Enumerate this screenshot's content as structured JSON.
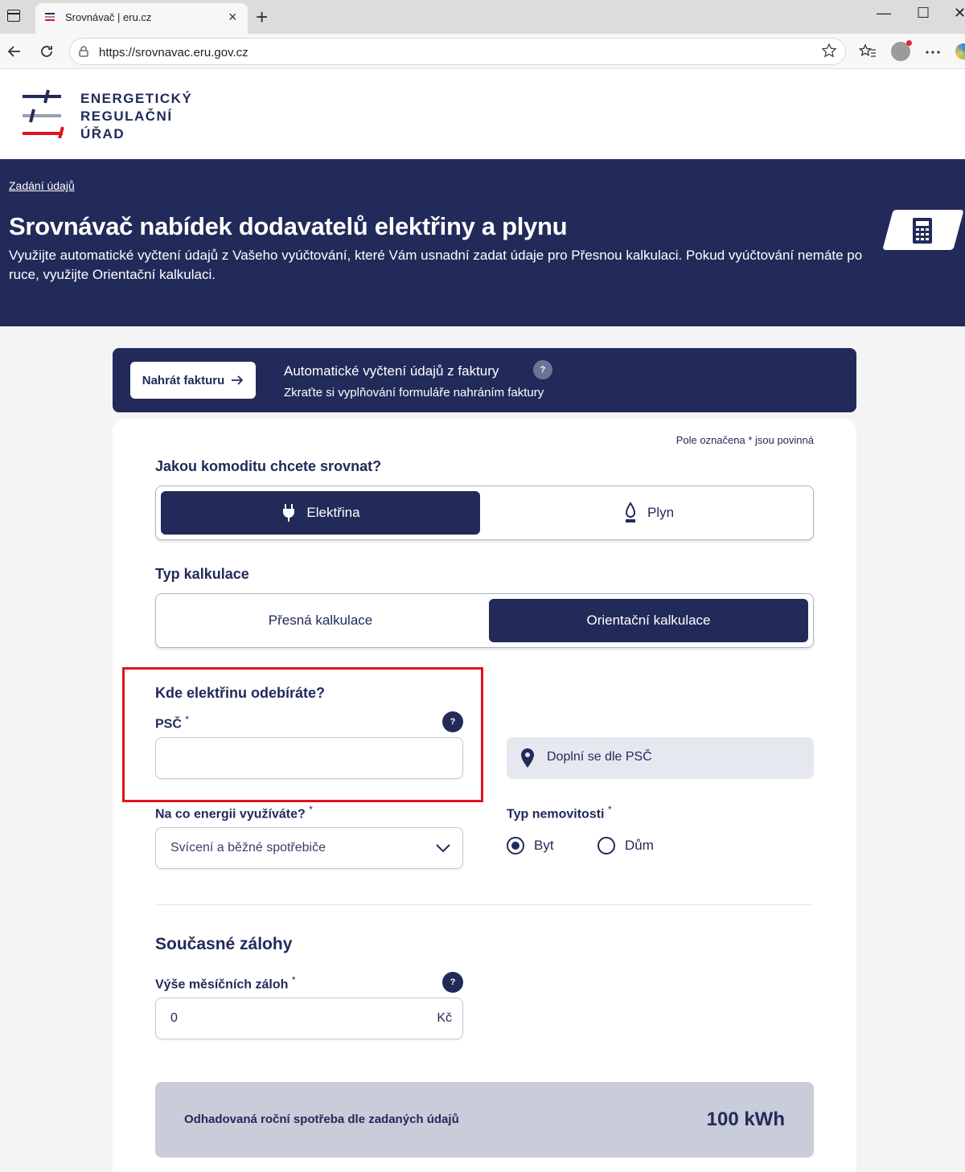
{
  "browser": {
    "tab_title": "Srovnávač | eru.cz",
    "tab_close": "×",
    "new_tab": "+",
    "url": "https://srovnavac.eru.gov.cz",
    "minimize": "—",
    "maximize": "☐",
    "close": "✕",
    "icons": [
      "back-icon",
      "reload-icon",
      "lock-icon",
      "star-icon",
      "favorites-icon",
      "profile-icon",
      "more-icon",
      "edge-icon"
    ]
  },
  "logo": {
    "lines": [
      "ENERGETICKÝ",
      "REGULAČNÍ",
      "ÚŘAD"
    ]
  },
  "hero": {
    "breadcrumb": "Zadání údajů",
    "title": "Srovnávač nabídek dodavatelů elektřiny a plynu",
    "description": "Využijte automatické vyčtení údajů z Vašeho vyúčtování, které Vám usnadní zadat údaje pro Přesnou kalkulaci. Pokud vyúčtování nemáte po ruce, využijte Orientační kalkulaci."
  },
  "upload": {
    "button_label": "Nahrát fakturu",
    "title": "Automatické vyčtení údajů z faktury",
    "subtitle": "Zkraťte si vyplňování formuláře nahráním faktury",
    "help": "?"
  },
  "form": {
    "required_note": "Pole označena * jsou povinná",
    "commodity": {
      "question": "Jakou komoditu chcete srovnat?",
      "options": [
        {
          "label": "Elektřina",
          "icon": "plug-icon",
          "selected": true
        },
        {
          "label": "Plyn",
          "icon": "flame-icon",
          "selected": false
        }
      ]
    },
    "calc_type": {
      "question": "Typ kalkulace",
      "options": [
        {
          "label": "Přesná kalkulace",
          "selected": false
        },
        {
          "label": "Orientační kalkulace",
          "selected": true
        }
      ]
    },
    "location": {
      "question": "Kde elektřinu odebíráte?",
      "psc_label": "PSČ",
      "required_mark": "*",
      "help": "?",
      "psc_value": "",
      "autofill_text": "Doplní se dle PSČ"
    },
    "usage": {
      "label": "Na co energii využíváte?",
      "required_mark": "*",
      "selected": "Svícení a běžné spotřebiče"
    },
    "property": {
      "label": "Typ nemovitosti",
      "required_mark": "*",
      "options": [
        {
          "label": "Byt",
          "selected": true
        },
        {
          "label": "Dům",
          "selected": false
        }
      ]
    },
    "deposits": {
      "section_title": "Současné zálohy",
      "label": "Výše měsíčních záloh",
      "required_mark": "*",
      "help": "?",
      "value": "0",
      "unit": "Kč"
    },
    "summary": {
      "label": "Odhadovaná roční spotřeba dle zadaných údajů",
      "value": "100 kWh"
    }
  },
  "colors": {
    "primary": "#222a5a",
    "highlight": "#e0141e",
    "summary_bg": "#c9ccd9"
  }
}
